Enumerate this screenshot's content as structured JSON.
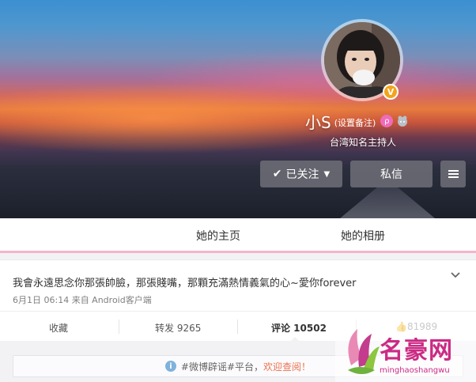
{
  "profile": {
    "name": "小S",
    "remark": "(设置备注)",
    "description": "台湾知名主持人",
    "verified_badge": "V",
    "member_badge": "ρ"
  },
  "buttons": {
    "follow_label": "已关注",
    "message_label": "私信"
  },
  "tabs": [
    {
      "label": "她的主页"
    },
    {
      "label": "她的相册"
    }
  ],
  "post": {
    "text": "我會永遠思念你那張帥臉，那張賤嘴，那顆充滿熱情義氣的心~愛你forever",
    "meta": "6月1日 06:14 来自 Android客户端"
  },
  "actions": {
    "favorite": "收藏",
    "forward": "转发 9265",
    "comment": "评论 10502",
    "like": "81989"
  },
  "notice": {
    "text": "#微博辟谣#平台，",
    "link": "欢迎查阅！"
  },
  "watermark": {
    "name": "名豪网",
    "url": "minghaoshangwu"
  },
  "colors": {
    "accent_pink": "#f5b4c8",
    "verified": "#f3a41b",
    "link": "#eb7350"
  }
}
